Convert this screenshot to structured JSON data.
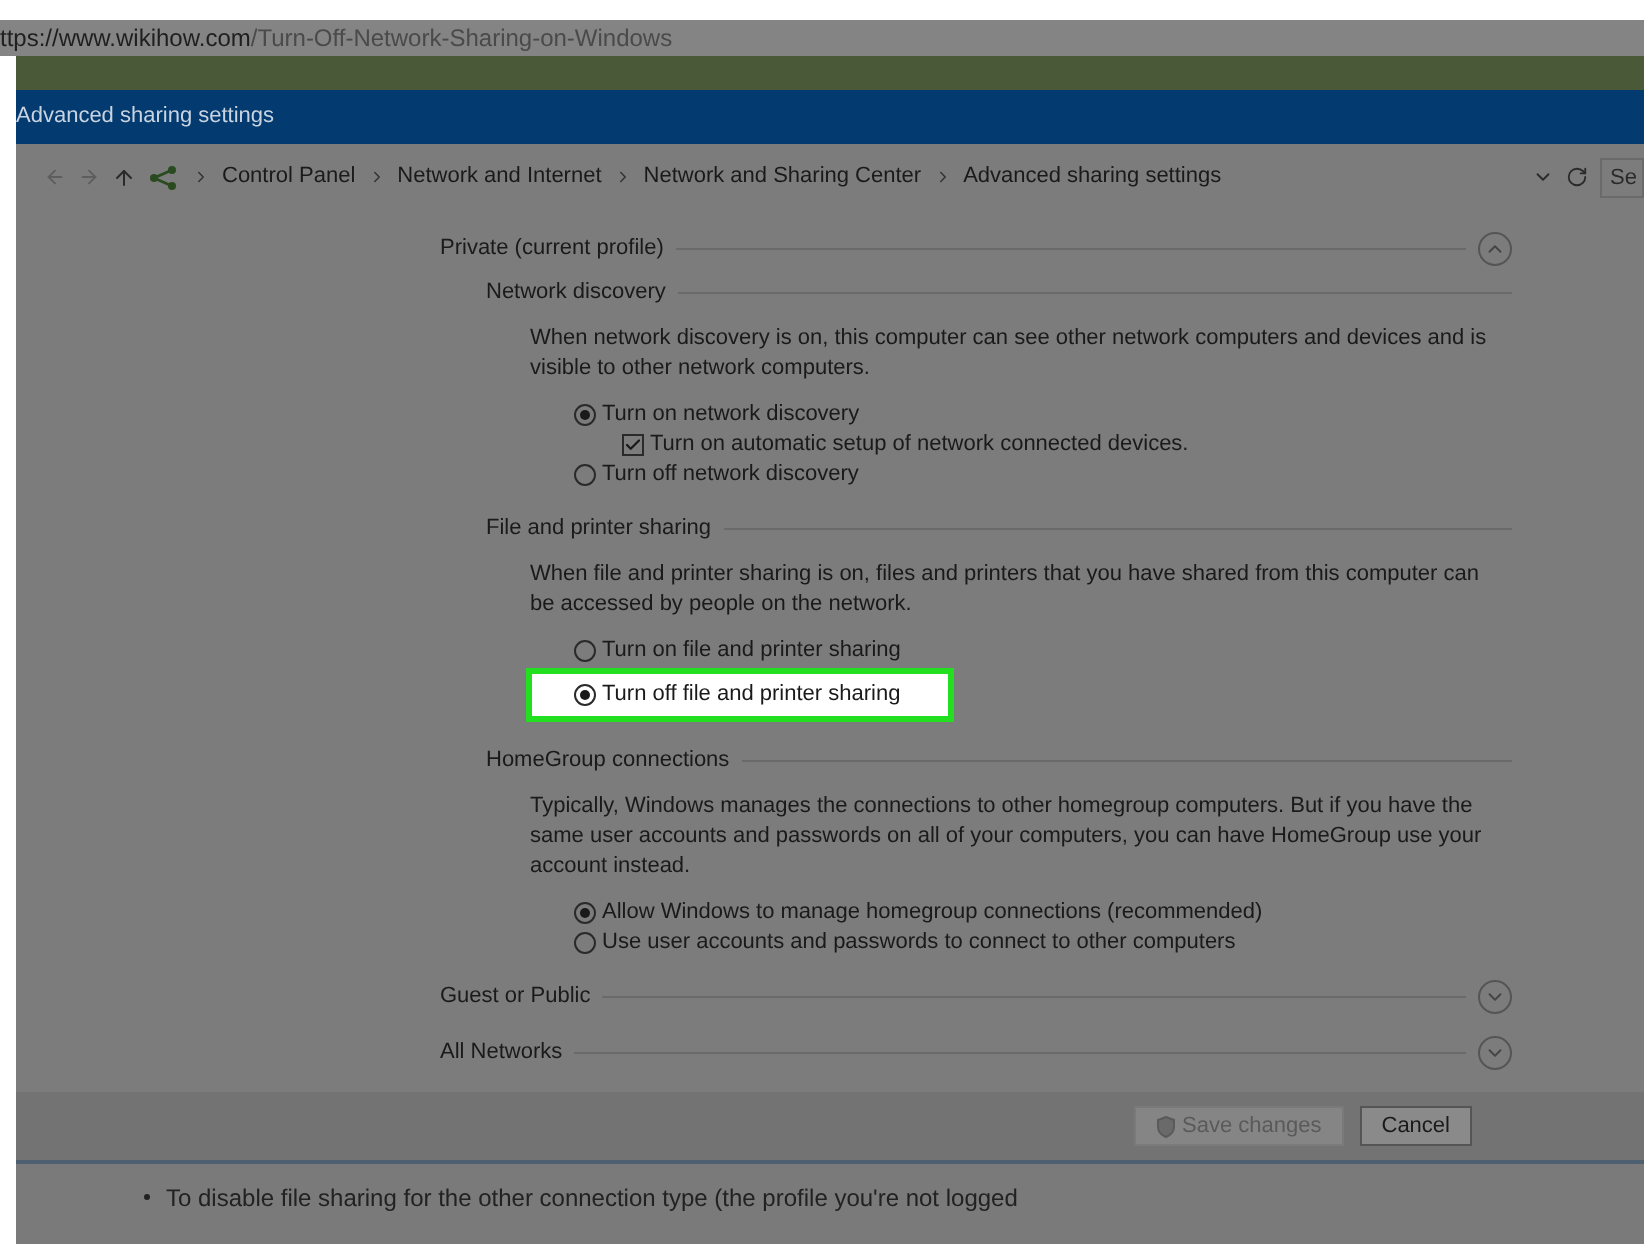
{
  "browser": {
    "url_host": "ttps://www.wikihow.com",
    "url_path": "/Turn-Off-Network-Sharing-on-Windows"
  },
  "window": {
    "title": "Advanced sharing settings"
  },
  "address_bar": {
    "breadcrumb": [
      "Control Panel",
      "Network and Internet",
      "Network and Sharing Center",
      "Advanced sharing settings"
    ],
    "search": {
      "placeholder": "Se"
    }
  },
  "profiles": [
    {
      "title": "Private (current profile)",
      "expanded": true,
      "sections": [
        {
          "title": "Network discovery",
          "description": "When network discovery is on, this computer can see other network computers and devices and is visible to other network computers.",
          "options": [
            {
              "kind": "radio",
              "label": "Turn on network discovery",
              "selected": true,
              "highlighted": false,
              "children": [
                {
                  "kind": "checkbox",
                  "label": "Turn on automatic setup of network connected devices.",
                  "checked": true
                }
              ]
            },
            {
              "kind": "radio",
              "label": "Turn off network discovery",
              "selected": false,
              "highlighted": false
            }
          ]
        },
        {
          "title": "File and printer sharing",
          "description": "When file and printer sharing is on, files and printers that you have shared from this computer can be accessed by people on the network.",
          "options": [
            {
              "kind": "radio",
              "label": "Turn on file and printer sharing",
              "selected": false,
              "highlighted": false
            },
            {
              "kind": "radio",
              "label": "Turn off file and printer sharing",
              "selected": true,
              "highlighted": true
            }
          ]
        },
        {
          "title": "HomeGroup connections",
          "description": "Typically, Windows manages the connections to other homegroup computers. But if you have the same user accounts and passwords on all of your computers, you can have HomeGroup use your account instead.",
          "options": [
            {
              "kind": "radio",
              "label": "Allow Windows to manage homegroup connections (recommended)",
              "selected": true,
              "highlighted": false
            },
            {
              "kind": "radio",
              "label": "Use user accounts and passwords to connect to other computers",
              "selected": false,
              "highlighted": false
            }
          ]
        }
      ]
    },
    {
      "title": "Guest or Public",
      "expanded": false
    },
    {
      "title": "All Networks",
      "expanded": false
    }
  ],
  "buttons": [
    {
      "label": "Save changes",
      "disabled": true,
      "shield": true
    },
    {
      "label": "Cancel",
      "disabled": false,
      "shield": false
    }
  ],
  "article": {
    "bullet": "To disable file sharing for the other connection type (the profile you're not logged"
  }
}
